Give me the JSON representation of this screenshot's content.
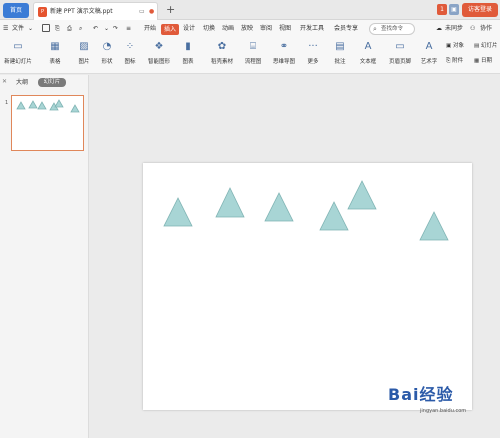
{
  "titlebar": {
    "home_tab": "首页",
    "doc_icon": "P",
    "doc_title": "新建 PPT 演示文稿.ppt",
    "new_tab": "+",
    "login_label": "访客登录"
  },
  "menubar": {
    "file_label": "文件",
    "tabs": [
      "开始",
      "插入",
      "设计",
      "切换",
      "动画",
      "放映",
      "审阅",
      "视图",
      "开发工具",
      "会员专享"
    ],
    "search_label": "查找命令",
    "sync_label": "未同步",
    "collab_label": "协作"
  },
  "ribbon": {
    "new_slide": "新建幻灯片",
    "table": "表格",
    "picture": "图片",
    "shape": "形状",
    "icons": "图标",
    "smart_graphic": "智能图形",
    "chart": "图表",
    "material": "稻壳素材",
    "flowchart": "流程图",
    "mindmap": "思维导图",
    "more": "更多",
    "comment": "批注",
    "textbox": "文本框",
    "header_footer": "页眉页脚",
    "wordart": "艺术字",
    "object": "对象",
    "attachment": "附件",
    "slide_number": "幻灯片",
    "date_time": "日期"
  },
  "left_panel": {
    "tab_outline": "大纲",
    "tab_slides": "幻灯片",
    "slide_number": "1"
  },
  "colors": {
    "triangle_fill": "#a8d5d5",
    "triangle_stroke": "#7fb3b3",
    "accent": "#e05a3a",
    "home_tab": "#3b7cd6"
  },
  "slide": {
    "shape": "triangle",
    "triangle_count": 6
  },
  "watermark": {
    "logo": "Bai经验",
    "sub": "jingyan.baidu.com"
  }
}
